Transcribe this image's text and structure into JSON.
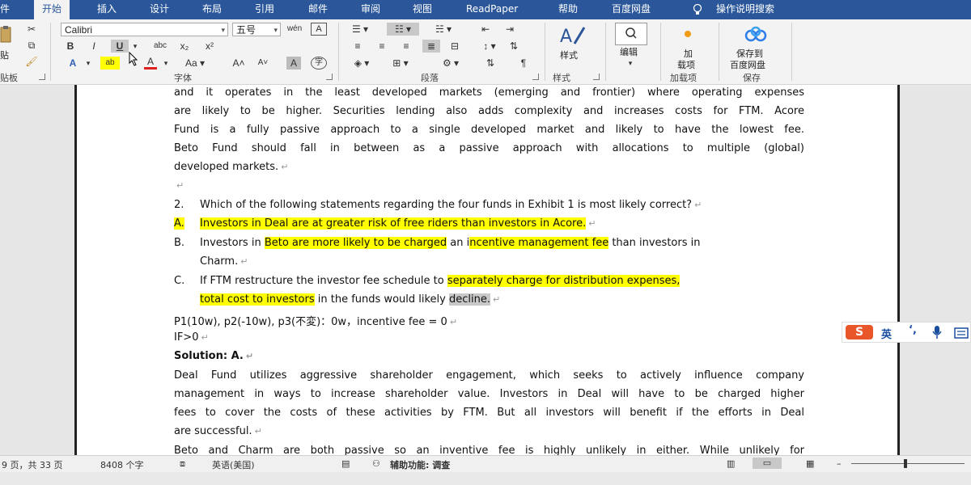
{
  "ribbon": {
    "tabs": [
      "件",
      "开始",
      "插入",
      "设计",
      "布局",
      "引用",
      "邮件",
      "审阅",
      "视图",
      "ReadPaper",
      "帮助",
      "百度网盘",
      "操作说明搜索"
    ],
    "font_name": "Calibri",
    "font_size": "五号",
    "groups": {
      "clipboard_short": "贴板",
      "paste_short": "贴",
      "font": "字体",
      "paragraph": "段落",
      "styles": "样式",
      "addins": "加载项",
      "save": "保存"
    },
    "buttons": {
      "bold": "B",
      "italic": "I",
      "underline": "U",
      "strike": "abc",
      "subscript": "x₂",
      "superscript": "x²",
      "styles": "样式",
      "editing": "编辑",
      "addin_line1": "加",
      "addin_line2": "载项",
      "save_line1": "保存到",
      "save_line2": "百度网盘"
    }
  },
  "document": {
    "lines": [
      "and it operates in the least developed markets (emerging and frontier) where operating expenses",
      "are likely to be higher. Securities lending also adds complexity and increases costs for FTM. Acore",
      "Fund is a fully passive approach to a single developed market and likely to have the lowest fee.",
      "Beto Fund should fall in between as a passive approach with allocations to multiple (global)",
      "developed markets."
    ],
    "question_number": "2.",
    "question": "Which of the following statements regarding the four funds in Exhibit 1 is most likely correct?",
    "option_a_label": "A.",
    "option_a_text": "Investors in Deal are at greater risk of free riders than investors in Acore.",
    "option_b_label": "B.",
    "option_b_pre": "Investors in ",
    "option_b_hl1": "Beto are more likely to be charged",
    "option_b_mid": " an i",
    "option_b_hl2": "ncentive management fee",
    "option_b_post": " than investors in",
    "option_b_line2": "Charm.",
    "option_c_label": "C.",
    "option_c_pre": "If FTM restructure the investor fee schedule to ",
    "option_c_hl1": "separately charge for distribution expenses,",
    "option_c_hl2": "total cost to investors",
    "option_c_mid": " in the funds would likely ",
    "option_c_hl3": "decline.",
    "note1": "P1(10w), p2(-10w), p3(不変)：0w，incentive fee = 0",
    "note2": "IF>0",
    "solution": "Solution: A.",
    "explanation": [
      "Deal Fund utilizes aggressive shareholder engagement, which seeks to actively influence company",
      "management in ways to increase shareholder value. Investors in Deal will have to be charged higher",
      "fees to cover the costs of these activities by FTM. But all investors will benefit if the efforts in Deal",
      "are successful.",
      "Beto and Charm are both passive so an inventive fee is highly unlikely in either. While unlikely for"
    ],
    "para_mark": "↵"
  },
  "ime": {
    "logo": "S",
    "lang": "英"
  },
  "status": {
    "page": "9 页，共 33 页",
    "words": "8408 个字",
    "language": "英语(美国)",
    "accessibility": "辅助功能: 调查"
  }
}
